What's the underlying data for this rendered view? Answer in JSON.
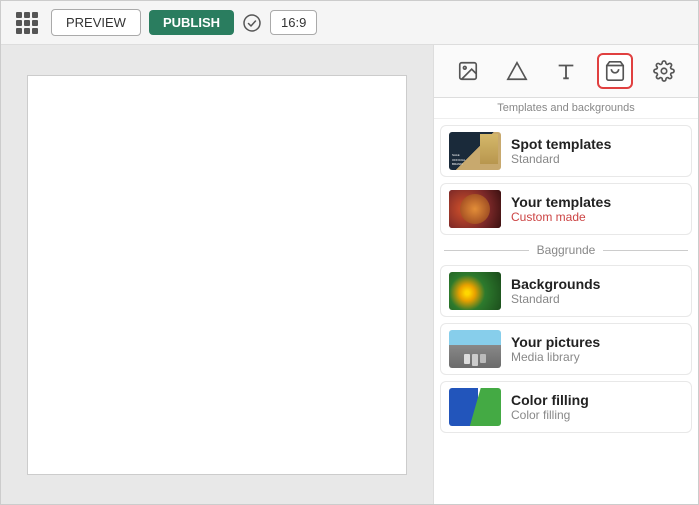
{
  "toolbar": {
    "preview_label": "PREVIEW",
    "publish_label": "PUBLISH",
    "ratio_label": "16:9"
  },
  "right_panel": {
    "panel_label": "Templates and backgrounds",
    "icon_buttons": [
      {
        "name": "image-icon",
        "symbol": "🖼",
        "active": false
      },
      {
        "name": "shape-icon",
        "symbol": "△",
        "active": false
      },
      {
        "name": "text-icon",
        "symbol": "T",
        "active": false
      },
      {
        "name": "cart-icon",
        "symbol": "🛒",
        "active": true
      },
      {
        "name": "settings-icon",
        "symbol": "⚙",
        "active": false
      }
    ],
    "section_templates_label": "Baggrunde",
    "items": [
      {
        "id": "spot-templates",
        "title": "Spot templates",
        "subtitle": "Standard",
        "subtitle_class": "standard",
        "thumb_type": "spot"
      },
      {
        "id": "your-templates",
        "title": "Your templates",
        "subtitle": "Custom made",
        "subtitle_class": "custom",
        "thumb_type": "your"
      }
    ],
    "bg_items": [
      {
        "id": "backgrounds",
        "title": "Backgrounds",
        "subtitle": "Standard",
        "subtitle_class": "standard",
        "thumb_type": "bg"
      },
      {
        "id": "your-pictures",
        "title": "Your pictures",
        "subtitle": "Media library",
        "subtitle_class": "standard",
        "thumb_type": "people"
      },
      {
        "id": "color-filling",
        "title": "Color filling",
        "subtitle": "Color filling",
        "subtitle_class": "standard",
        "thumb_type": "color"
      }
    ]
  }
}
